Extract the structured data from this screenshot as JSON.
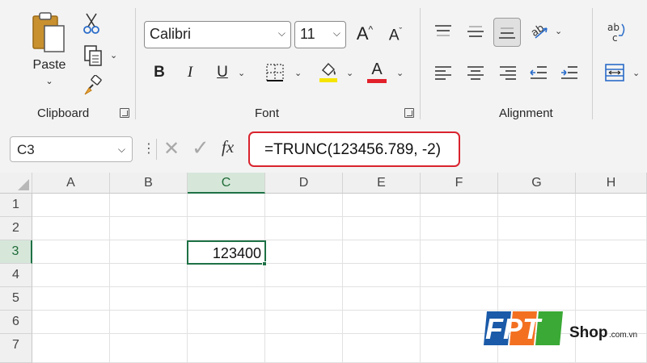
{
  "ribbon": {
    "clipboard": {
      "paste_label": "Paste",
      "group_label": "Clipboard"
    },
    "font": {
      "font_name": "Calibri",
      "font_size": "11",
      "bold": "B",
      "italic": "I",
      "underline": "U",
      "group_label": "Font",
      "font_color": "#e2202a",
      "highlight_color": "#f5e400"
    },
    "alignment": {
      "group_label": "Alignment"
    }
  },
  "formula_bar": {
    "name_box": "C3",
    "formula": "=TRUNC(123456.789, -2)",
    "fx_label": "fx"
  },
  "grid": {
    "columns": [
      "A",
      "B",
      "C",
      "D",
      "E",
      "F",
      "G",
      "H"
    ],
    "rows": [
      "1",
      "2",
      "3",
      "4",
      "5",
      "6",
      "7"
    ],
    "active_cell": "C3",
    "cells": {
      "C3": "123400"
    }
  },
  "watermark": {
    "brand": "FPT",
    "suffix": "Shop",
    "domain": ".com.vn"
  },
  "colors": {
    "accent_green": "#1e7145",
    "highlight_red": "#d9232e"
  }
}
